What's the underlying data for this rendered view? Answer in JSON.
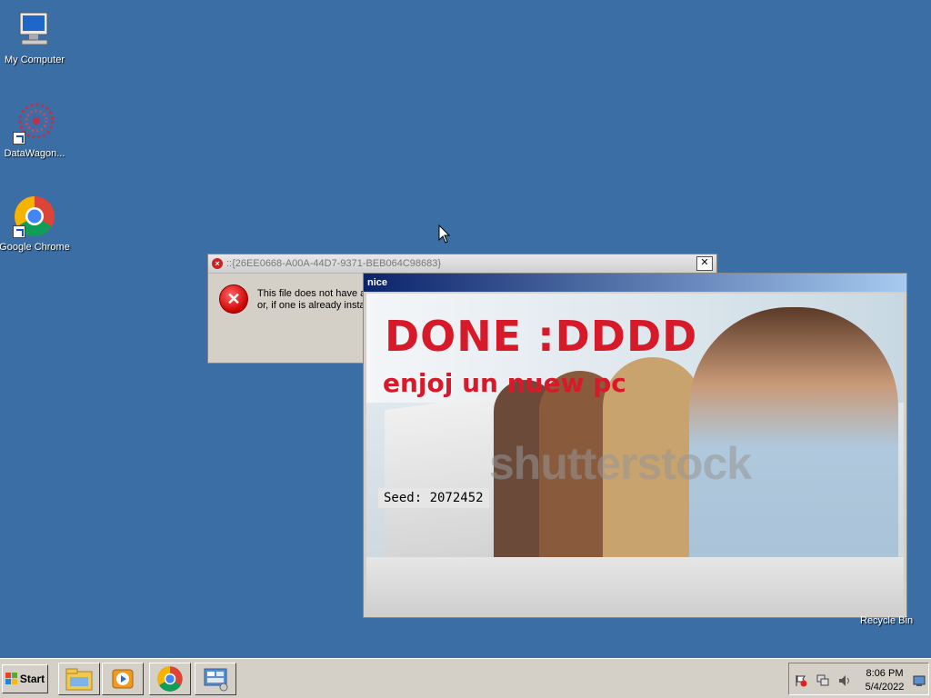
{
  "desktop": {
    "icons": [
      {
        "label": "My Computer",
        "icon": "computer-icon"
      },
      {
        "label": "DataWagon...",
        "icon": "datawagon-icon"
      },
      {
        "label": "Google Chrome",
        "icon": "chrome-icon"
      }
    ],
    "recycle_bin_label": "Recycle Bin"
  },
  "error_dialog": {
    "title": "::{26EE0668-A00A-44D7-9371-BEB064C98683}",
    "close_label": "✕",
    "message_line1": "This file does not have a",
    "message_line2": "or, if one is already insta"
  },
  "nice_window": {
    "title": "nice",
    "headline": "DONE :DDDD",
    "subline": "enjoj un nuew pc",
    "watermark": "shutterstock",
    "seed": "Seed: 2072452"
  },
  "taskbar": {
    "start_label": "Start",
    "pinned": [
      "explorer-icon",
      "media-player-icon",
      "chrome-icon",
      "server-manager-icon"
    ],
    "clock_time": "8:06 PM",
    "clock_date": "5/4/2022"
  },
  "colors": {
    "desktop": "#3a6ea5",
    "accent_red": "#d61a2a",
    "title_active": "#0a246a"
  }
}
